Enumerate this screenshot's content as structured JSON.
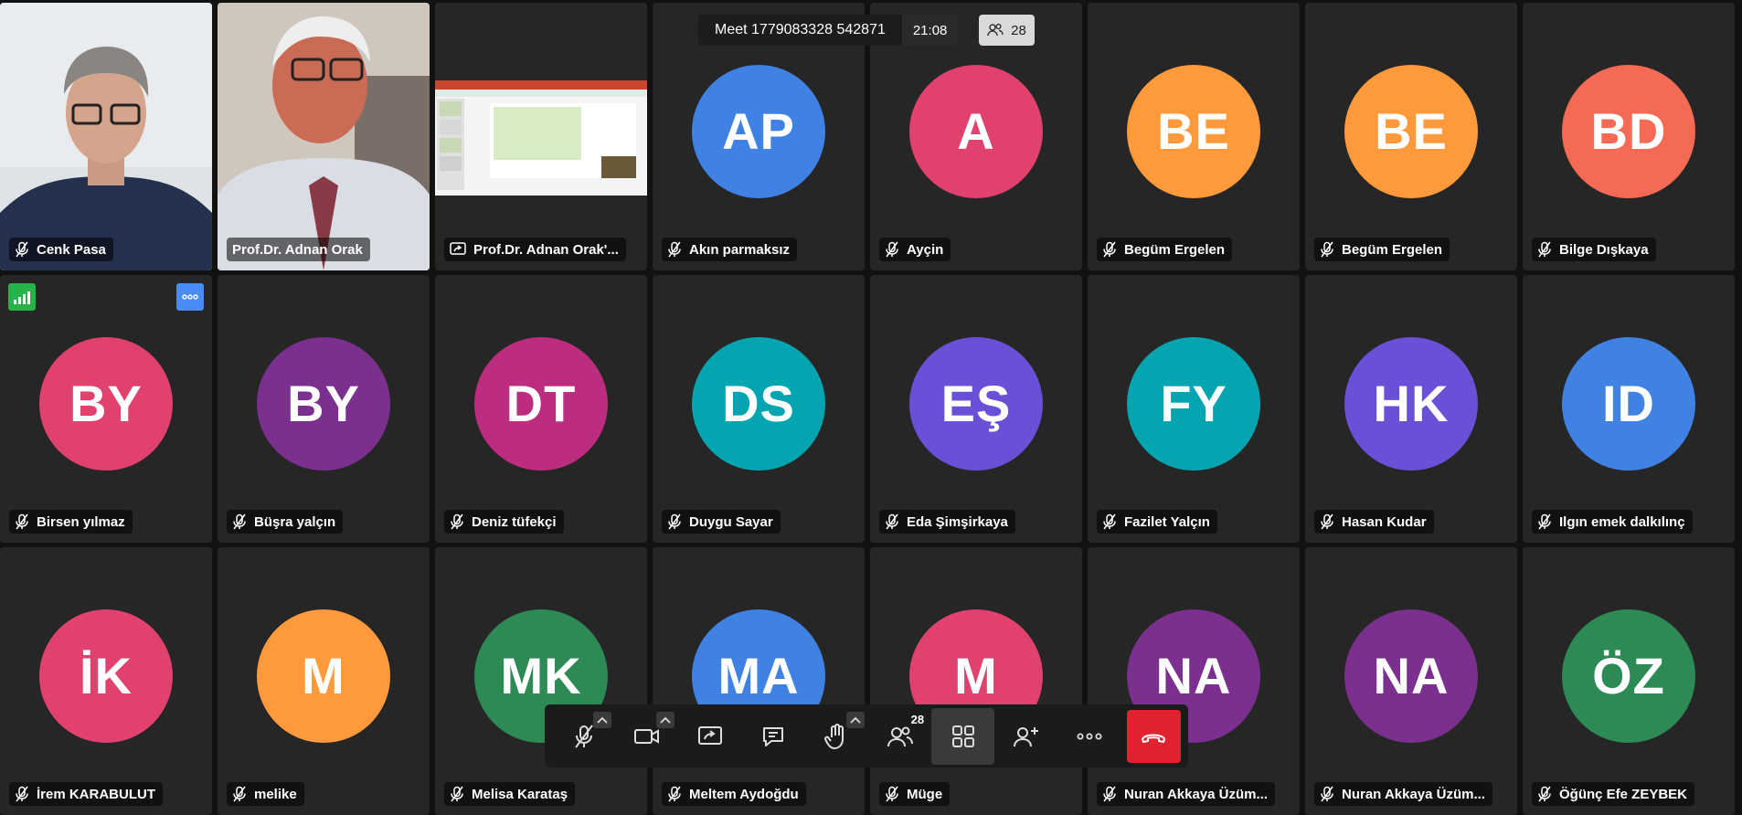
{
  "meeting": {
    "title": "Meet 1779083328 542871",
    "time": "21:08",
    "participant_count": "28"
  },
  "colors": {
    "blue": "#3f82e4",
    "pink": "#e0426d",
    "orange": "#ff9a3c",
    "coral": "#f56a55",
    "purple": "#7b2f8e",
    "magenta": "#bd2d7f",
    "teal": "#04a5b0",
    "violet": "#6a4fd7",
    "green": "#2c8a55"
  },
  "tiles": [
    {
      "name": "Cenk Pasa",
      "initials": "",
      "color": "",
      "video": "person1",
      "icon": "mic-off-icon"
    },
    {
      "name": "Prof.Dr. Adnan Orak",
      "initials": "",
      "color": "",
      "video": "person2",
      "icon": "",
      "active": true
    },
    {
      "name": "Prof.Dr. Adnan Orak'...",
      "initials": "",
      "color": "",
      "video": "screen",
      "icon": "screen-share-icon"
    },
    {
      "name": "Akın parmaksız",
      "initials": "AP",
      "color": "#3f82e4",
      "icon": "mic-off-icon"
    },
    {
      "name": "Ayçin",
      "initials": "A",
      "color": "#e0426d",
      "icon": "mic-off-icon"
    },
    {
      "name": "Begüm Ergelen",
      "initials": "BE",
      "color": "#ff9a3c",
      "icon": "mic-off-icon"
    },
    {
      "name": "Begüm Ergelen",
      "initials": "BE",
      "color": "#ff9a3c",
      "icon": "mic-off-icon"
    },
    {
      "name": "Bilge Dışkaya",
      "initials": "BD",
      "color": "#f56a55",
      "icon": "mic-off-icon"
    },
    {
      "name": "Birsen yılmaz",
      "initials": "BY",
      "color": "#e0426d",
      "icon": "mic-off-icon",
      "extras": true
    },
    {
      "name": "Büşra yalçın",
      "initials": "BY",
      "color": "#7b2f8e",
      "icon": "mic-off-icon"
    },
    {
      "name": "Deniz tüfekçi",
      "initials": "DT",
      "color": "#bd2d7f",
      "icon": "mic-off-icon"
    },
    {
      "name": "Duygu Sayar",
      "initials": "DS",
      "color": "#04a5b0",
      "icon": "mic-off-icon"
    },
    {
      "name": "Eda Şimşirkaya",
      "initials": "EŞ",
      "color": "#6a4fd7",
      "icon": "mic-off-icon"
    },
    {
      "name": "Fazilet Yalçın",
      "initials": "FY",
      "color": "#04a5b0",
      "icon": "mic-off-icon"
    },
    {
      "name": "Hasan Kudar",
      "initials": "HK",
      "color": "#6a4fd7",
      "icon": "mic-off-icon"
    },
    {
      "name": "Ilgın emek dalkılınç",
      "initials": "ID",
      "color": "#3f82e4",
      "icon": "mic-off-icon"
    },
    {
      "name": "İrem KARABULUT",
      "initials": "İK",
      "color": "#e0426d",
      "icon": "mic-off-icon"
    },
    {
      "name": "melike",
      "initials": "M",
      "color": "#ff9a3c",
      "icon": "mic-off-icon"
    },
    {
      "name": "Melisa Karataş",
      "initials": "MK",
      "color": "#2c8a55",
      "icon": "mic-off-icon"
    },
    {
      "name": "Meltem Aydoğdu",
      "initials": "MA",
      "color": "#3f82e4",
      "icon": "mic-off-icon"
    },
    {
      "name": "Müge",
      "initials": "M",
      "color": "#e0426d",
      "icon": "mic-off-icon"
    },
    {
      "name": "Nuran Akkaya Üzüm...",
      "initials": "NA",
      "color": "#7b2f8e",
      "icon": "mic-off-icon"
    },
    {
      "name": "Nuran Akkaya Üzüm...",
      "initials": "NA",
      "color": "#7b2f8e",
      "icon": "mic-off-icon"
    },
    {
      "name": "Öğünç Efe ZEYBEK",
      "initials": "ÖZ",
      "color": "#2c8a55",
      "icon": "mic-off-icon"
    }
  ],
  "toolbar": {
    "participants_badge": "28",
    "buttons": [
      "mic-toggle",
      "camera-toggle",
      "share-screen",
      "chat",
      "raise-hand",
      "participants",
      "layout",
      "invite",
      "more",
      "leave"
    ]
  }
}
